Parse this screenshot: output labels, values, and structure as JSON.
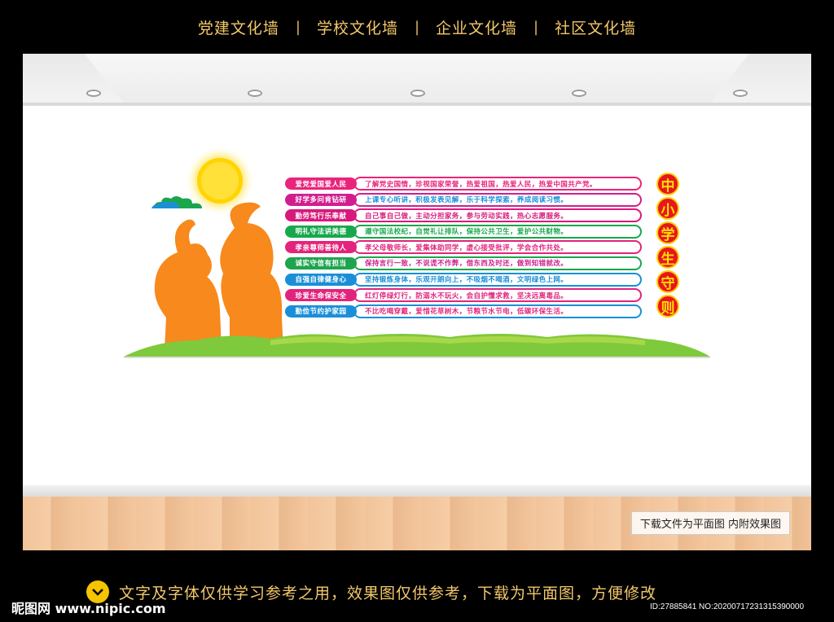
{
  "topnav": {
    "items": [
      "党建文化墙",
      "学校文化墙",
      "企业文化墙",
      "社区文化墙"
    ]
  },
  "wall": {
    "title_chars": [
      "中",
      "小",
      "学",
      "生",
      "守",
      "则"
    ],
    "rules": [
      {
        "label": "爱党爱国爱人民",
        "text": "了解党史国情，珍视国家荣誉，热爱祖国，热爱人民，热爱中国共产党。",
        "color": "#e8247b"
      },
      {
        "label": "好学多问肯钻研",
        "text": "上课专心听讲，积极发表见解，乐于科学探索，养成阅读习惯。",
        "color": "#d11e8f"
      },
      {
        "label": "勤劳笃行乐奉献",
        "text": "自己事自己做，主动分担家务，参与劳动实践，热心志愿服务。",
        "color": "#d8197b"
      },
      {
        "label": "明礼守法讲美德",
        "text": "遵守国法校纪，自觉礼让排队，保持公共卫生，爱护公共财物。",
        "color": "#18a84c"
      },
      {
        "label": "孝亲尊师善待人",
        "text": "孝父母敬师长，爱集体助同学，虚心接受批评，学会合作共处。",
        "color": "#e2247c"
      },
      {
        "label": "诚实守信有担当",
        "text": "保持言行一致，不说谎不作弊，借东西及时还，做到知错就改。",
        "color": "#1ea44f"
      },
      {
        "label": "自强自律健身心",
        "text": "坚持锻炼身体，乐观开朗向上，不吸烟不喝酒，文明绿色上网。",
        "color": "#1a8fd8"
      },
      {
        "label": "珍爱生命保安全",
        "text": "红灯停绿灯行，防溺水不玩火，会自护懂求救，坚决远离毒品。",
        "color": "#e0247c"
      },
      {
        "label": "勤俭节约护家园",
        "text": "不比吃喝穿戴，爱惜花草树木，节粮节水节电，低碳环保生活。",
        "color": "#1a8fd8"
      }
    ]
  },
  "floor_note": "下载文件为平面图  内附效果图",
  "caption": "文字及字体仅供学习参考之用，效果图仅供参考，下载为平面图，方便修改",
  "watermark": {
    "logo": "昵图网 www.nipic.com",
    "id": "ID:27885841 NO:20200717231315390000"
  }
}
